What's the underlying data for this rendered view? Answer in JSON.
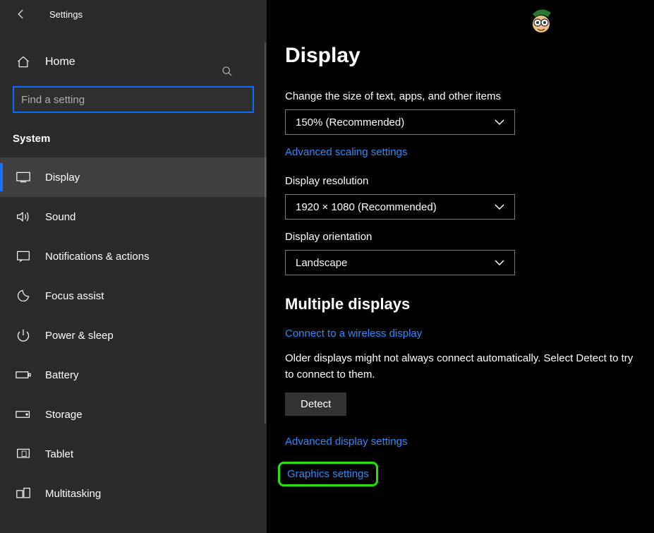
{
  "titlebar": {
    "title": "Settings"
  },
  "home": {
    "label": "Home"
  },
  "search": {
    "placeholder": "Find a setting"
  },
  "category": {
    "label": "System"
  },
  "nav": {
    "items": [
      {
        "label": "Display"
      },
      {
        "label": "Sound"
      },
      {
        "label": "Notifications & actions"
      },
      {
        "label": "Focus assist"
      },
      {
        "label": "Power & sleep"
      },
      {
        "label": "Battery"
      },
      {
        "label": "Storage"
      },
      {
        "label": "Tablet"
      },
      {
        "label": "Multitasking"
      }
    ]
  },
  "page": {
    "title": "Display",
    "scale_label": "Change the size of text, apps, and other items",
    "scale_value": "150% (Recommended)",
    "adv_scaling": "Advanced scaling settings",
    "resolution_label": "Display resolution",
    "resolution_value": "1920 × 1080 (Recommended)",
    "orientation_label": "Display orientation",
    "orientation_value": "Landscape",
    "multi_header": "Multiple displays",
    "connect_link": "Connect to a wireless display",
    "detect_para": "Older displays might not always connect automatically. Select Detect to try to connect to them.",
    "detect_btn": "Detect",
    "adv_display": "Advanced display settings",
    "graphics": "Graphics settings"
  }
}
